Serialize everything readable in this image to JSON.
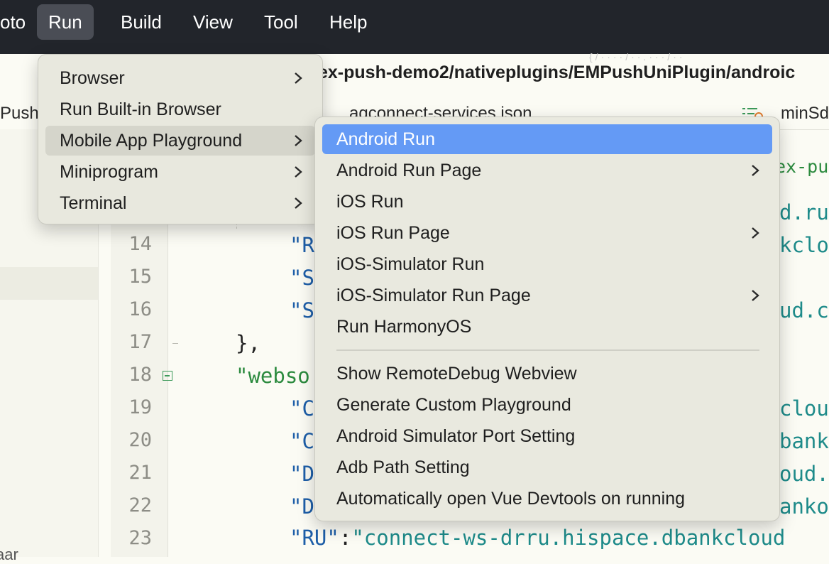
{
  "menubar": {
    "items": [
      {
        "label": "oto"
      },
      {
        "label": "Run",
        "active": true
      },
      {
        "label": "Build"
      },
      {
        "label": "View"
      },
      {
        "label": "Tool"
      },
      {
        "label": "Help"
      }
    ]
  },
  "editor": {
    "path": "ex-push-demo2/nativeplugins/EMPushUniPlugin/androic",
    "tab_left": "PushU",
    "tab_file": "agconnect-services.json",
    "tab_right": "minSd",
    "line_numbers": [
      "14",
      "15",
      "16",
      "17",
      "18",
      "19",
      "20",
      "21",
      "22",
      "23"
    ],
    "code": {
      "top_right_green": "ex-pu",
      "r_frag_d_ru": "d.ru",
      "r_frag_kclo": "kclo",
      "r_frag_ud_c": "ud.c",
      "r_frag_cloud": "cloud",
      "r_frag_bank": "bank",
      "r_frag_oud": "oud.",
      "r_frag_anko": "anko",
      "line14": "\"R",
      "line15": "\"S",
      "line16": "\"S",
      "line17": "},",
      "line18": "\"webso",
      "line19": "\"C",
      "line20": "\"C",
      "line21": "\"D",
      "line22": "\"D",
      "line23_key": "\"RU\"",
      "line23_colon": ":",
      "line23_value": "\"connect-ws-drru.hispace.dbankcloud"
    },
    "sidebar_bottom": "aar"
  },
  "run_menu": {
    "items": [
      {
        "label": "Browser",
        "submenu": true
      },
      {
        "label": "Run Built-in Browser",
        "submenu": false
      },
      {
        "label": "Mobile App Playground",
        "submenu": true,
        "hover": true
      },
      {
        "label": "Miniprogram",
        "submenu": true
      },
      {
        "label": "Terminal",
        "submenu": true
      }
    ]
  },
  "submenu": {
    "items": [
      {
        "label": "Android Run",
        "submenu": false,
        "selected": true
      },
      {
        "label": "Android Run Page",
        "submenu": true
      },
      {
        "label": "iOS Run",
        "submenu": false
      },
      {
        "label": "iOS Run Page",
        "submenu": true
      },
      {
        "label": "iOS-Simulator Run",
        "submenu": false
      },
      {
        "label": "iOS-Simulator Run Page",
        "submenu": true
      },
      {
        "label": "Run HarmonyOS",
        "submenu": false
      },
      {
        "label": "Show RemoteDebug Webview",
        "submenu": false
      },
      {
        "label": "Generate Custom Playground",
        "submenu": false
      },
      {
        "label": "Android Simulator Port Setting",
        "submenu": false
      },
      {
        "label": "Adb Path Setting",
        "submenu": false
      },
      {
        "label": "Automatically open Vue Devtools on running",
        "submenu": false
      }
    ]
  },
  "colors": {
    "menubar_bg": "#22252b",
    "selected_item": "#649af5",
    "code_key": "#1d5ea8",
    "code_string": "#1e8b8a"
  }
}
